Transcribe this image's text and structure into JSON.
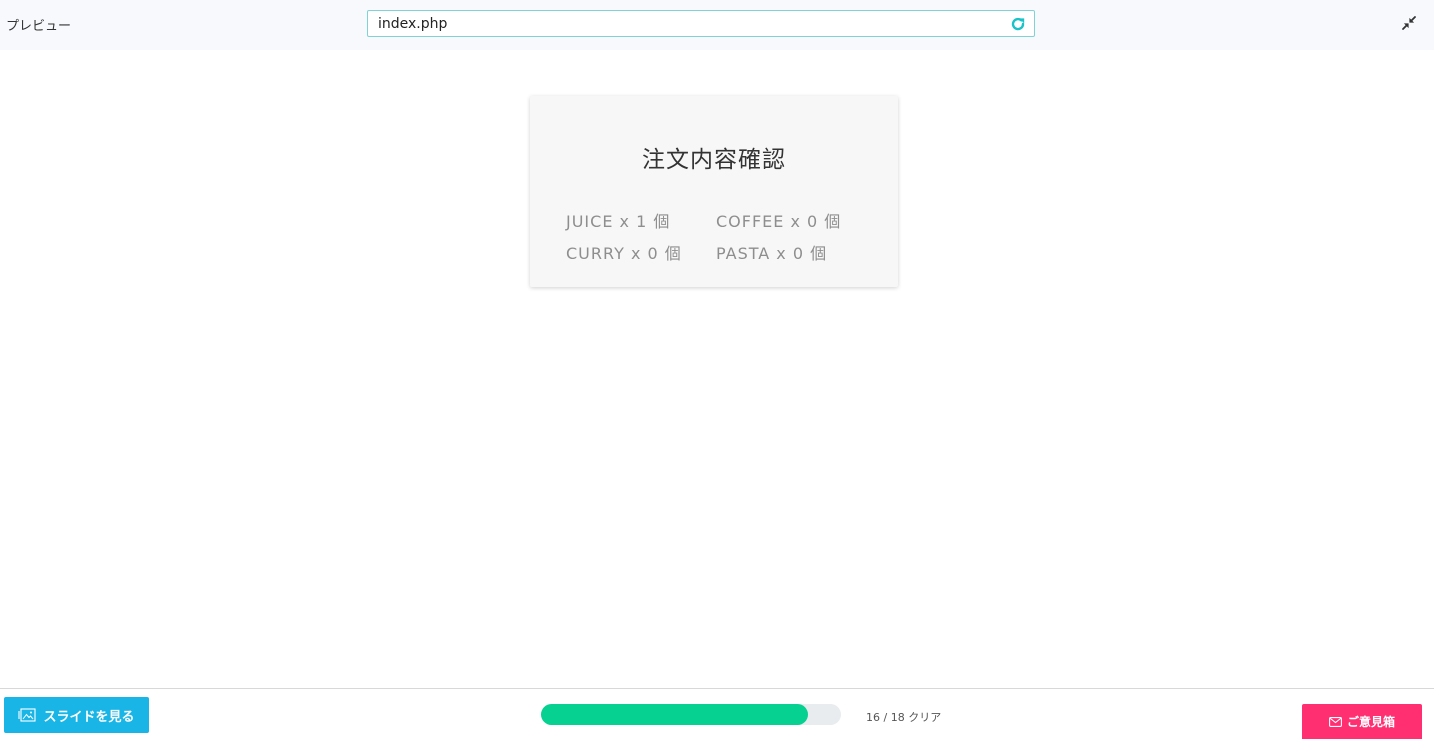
{
  "header": {
    "title": "プレビュー",
    "url": "index.php",
    "reload_icon": "reload-icon",
    "collapse_icon": "collapse-icon"
  },
  "card": {
    "title": "注文内容確認",
    "items": [
      {
        "text": "JUICE x 1 個"
      },
      {
        "text": "COFFEE x 0 個"
      },
      {
        "text": "CURRY x 0 個"
      },
      {
        "text": "PASTA x 0 個"
      }
    ]
  },
  "footer": {
    "slide_button_label": "スライドを見る",
    "slide_icon": "image-icon",
    "progress": {
      "completed": 16,
      "total": 18,
      "label": "16 / 18 クリア"
    },
    "feedback_button_label": "ご意見箱",
    "feedback_icon": "mail-icon"
  },
  "colors": {
    "accent_teal": "#19c3c8",
    "slide_button": "#19b5e6",
    "progress_fill": "#06d191",
    "feedback_button": "#ff2f72"
  }
}
